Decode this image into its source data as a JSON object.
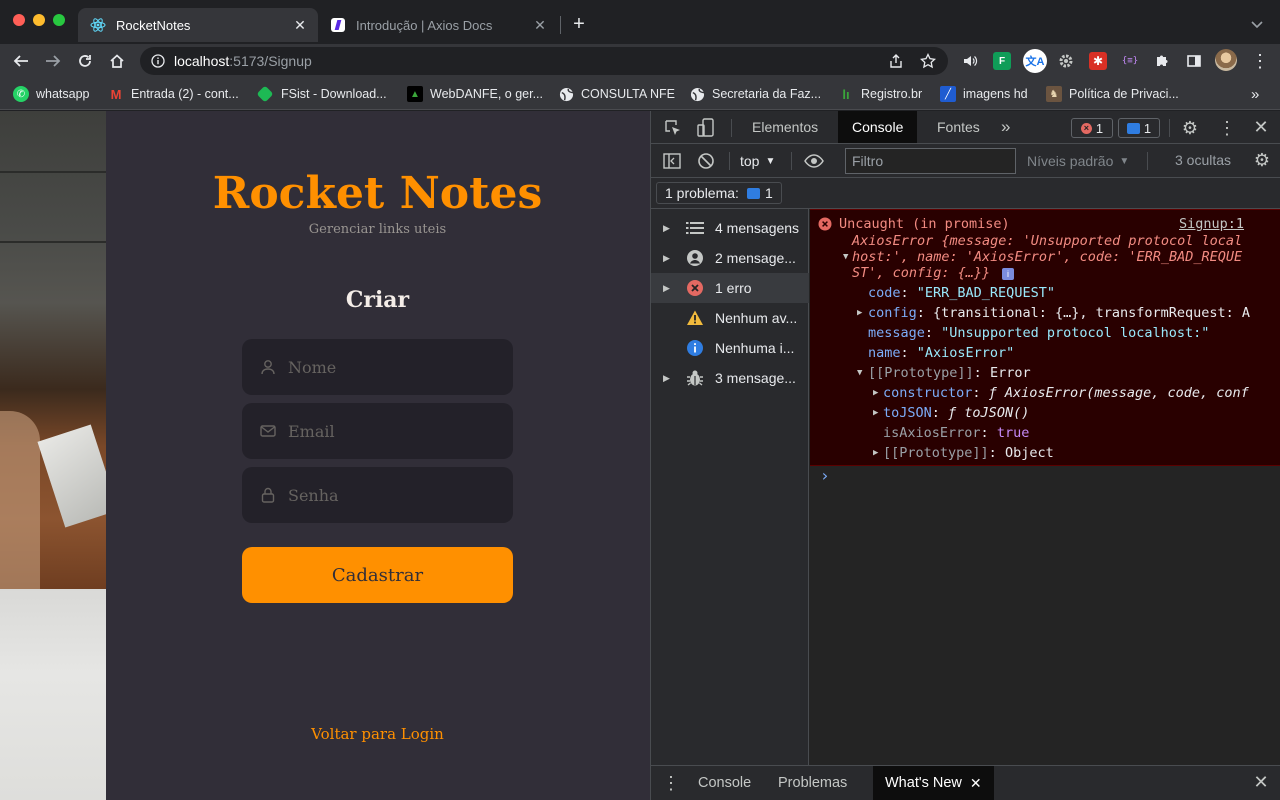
{
  "browser": {
    "tabs": [
      {
        "title": "RocketNotes",
        "active": true,
        "icon": "react-icon"
      },
      {
        "title": "Introdução | Axios Docs",
        "active": false,
        "icon": "axios-icon"
      }
    ],
    "new_tab": "+",
    "url_host": "localhost",
    "url_rest": ":5173/Signup"
  },
  "bookmarks": [
    {
      "label": "whatsapp",
      "icon": "whatsapp-icon",
      "color": "#25d366"
    },
    {
      "label": "Entrada (2) - cont...",
      "icon": "gmail-icon",
      "color": "#ea4335"
    },
    {
      "label": "FSist - Download...",
      "icon": "fsist-icon",
      "color": "#1db954"
    },
    {
      "label": "WebDANFE, o ger...",
      "icon": "webdanfe-icon",
      "color": "#111111"
    },
    {
      "label": "CONSULTA NFE",
      "icon": "globe-icon",
      "color": "#e8eaed"
    },
    {
      "label": "Secretaria da Faz...",
      "icon": "globe-icon",
      "color": "#e8eaed"
    },
    {
      "label": "Registro.br",
      "icon": "registro-icon",
      "color": "#3aa53a"
    },
    {
      "label": "imagens hd",
      "icon": "imagens-icon",
      "color": "#1f5cd1"
    },
    {
      "label": "Política de Privaci...",
      "icon": "privacy-icon",
      "color": "#b08a55"
    }
  ],
  "bookmarks_more": "»",
  "app": {
    "title": "Rocket Notes",
    "subtitle": "Gerenciar links uteis",
    "form_heading": "Criar",
    "name_placeholder": "Nome",
    "email_placeholder": "Email",
    "password_placeholder": "Senha",
    "submit_label": "Cadastrar",
    "back_link": "Voltar para Login",
    "accent_color": "#ff9000"
  },
  "devtools": {
    "tabs": [
      "Elementos",
      "Console",
      "Fontes"
    ],
    "active_tab": "Console",
    "more": "»",
    "error_count": "1",
    "message_count": "1",
    "context": "top",
    "filter_placeholder": "Filtro",
    "levels": "Níveis padrão",
    "hidden": "3 ocultas",
    "issues_label": "1 problema:",
    "issues_count": "1",
    "sidebar": [
      {
        "label": "4 mensagens",
        "icon": "list-icon",
        "expandable": true,
        "selected": false
      },
      {
        "label": "2 mensage...",
        "icon": "user-icon",
        "expandable": true,
        "selected": false
      },
      {
        "label": "1 erro",
        "icon": "error-icon",
        "expandable": true,
        "selected": true
      },
      {
        "label": "Nenhum av...",
        "icon": "warning-icon",
        "expandable": false,
        "selected": false
      },
      {
        "label": "Nenhuma i...",
        "icon": "info-icon",
        "expandable": false,
        "selected": false
      },
      {
        "label": "3 mensage...",
        "icon": "bug-icon",
        "expandable": true,
        "selected": false
      }
    ],
    "console": {
      "error_title": "Uncaught (in promise)",
      "source_link": "Signup:1",
      "error_summary_line1": "AxiosError {message: 'Unsupported protocol local",
      "error_summary_line2": "host:', name: 'AxiosError', code: 'ERR_BAD_REQUE",
      "error_summary_line3": "ST', config: {…}}",
      "code_key": "code",
      "code_val": "\"ERR_BAD_REQUEST\"",
      "config_key": "config",
      "config_val": "{transitional: {…}, transformRequest: A",
      "message_key": "message",
      "message_val": "\"Unsupported protocol localhost:\"",
      "name_key": "name",
      "name_val": "\"AxiosError\"",
      "proto_key": "[[Prototype]]",
      "proto_val": "Error",
      "ctor_key": "constructor",
      "ctor_val": "ƒ AxiosError(message, code, conf",
      "tojson_key": "toJSON",
      "tojson_val": "ƒ toJSON()",
      "isaxios_key": "isAxiosError",
      "isaxios_val": "true",
      "proto2_key": "[[Prototype]]",
      "proto2_val": "Object",
      "prompt": "›"
    },
    "drawer_tabs": [
      "Console",
      "Problemas",
      "What's New"
    ],
    "drawer_active": "What's New"
  }
}
